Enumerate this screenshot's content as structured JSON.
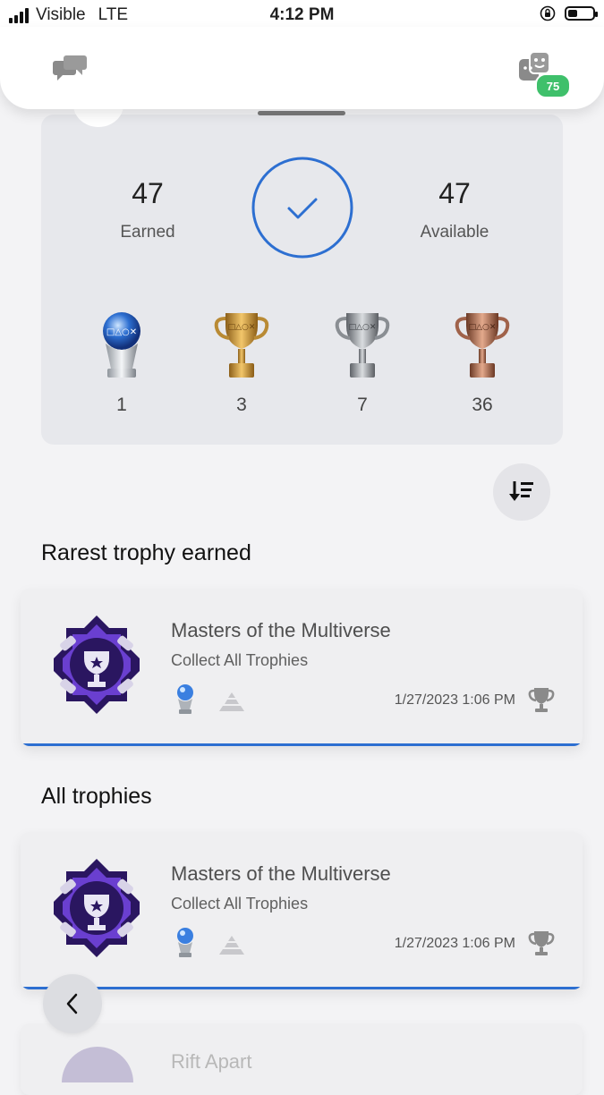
{
  "status_bar": {
    "carrier": "Visible",
    "network": "LTE",
    "time": "4:12 PM",
    "battery_level": 0.4
  },
  "top_bar": {
    "chat_icon": "chat-bubbles-icon",
    "friends_icon": "friends-icon",
    "friends_badge": "75",
    "badge_color": "#3fc06b"
  },
  "summary": {
    "earned_value": "47",
    "earned_label": "Earned",
    "available_value": "47",
    "available_label": "Available",
    "completion": 1.0,
    "ring_color": "#2d6fd1",
    "trophies": [
      {
        "type": "platinum",
        "icon": "platinum-trophy-icon",
        "count": "1"
      },
      {
        "type": "gold",
        "icon": "gold-trophy-icon",
        "count": "3"
      },
      {
        "type": "silver",
        "icon": "silver-trophy-icon",
        "count": "7"
      },
      {
        "type": "bronze",
        "icon": "bronze-trophy-icon",
        "count": "36"
      }
    ]
  },
  "sort_button_icon": "sort-descending-icon",
  "rarest_section": {
    "title": "Rarest trophy earned",
    "card": {
      "name": "Masters of the Multiverse",
      "description": "Collect All Trophies",
      "date": "1/27/2023  1:06 PM",
      "trophy_type": "platinum",
      "rarity_icon": "rarity-pyramid-icon"
    }
  },
  "all_section": {
    "title": "All trophies",
    "cards": [
      {
        "name": "Masters of the Multiverse",
        "description": "Collect All Trophies",
        "date": "1/27/2023  1:06 PM",
        "trophy_type": "platinum",
        "rarity_icon": "rarity-pyramid-icon"
      },
      {
        "name": "Rift Apart"
      }
    ]
  },
  "back_button_icon": "chevron-left-icon",
  "accent_color": "#2d6fd1"
}
